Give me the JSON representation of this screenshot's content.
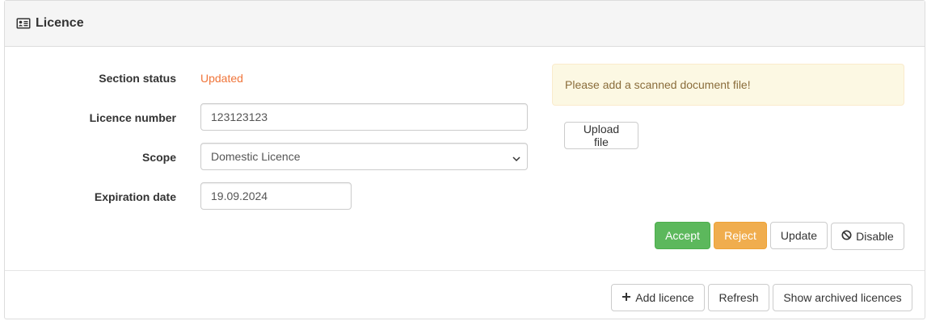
{
  "panel": {
    "title": "Licence",
    "title_icon": "id-card-icon"
  },
  "form": {
    "section_status": {
      "label": "Section status",
      "value": "Updated",
      "color": "#f0753a"
    },
    "licence_number": {
      "label": "Licence number",
      "value": "123123123"
    },
    "scope": {
      "label": "Scope",
      "selected": "Domestic Licence"
    },
    "expiration_date": {
      "label": "Expiration date",
      "value": "19.09.2024"
    }
  },
  "document": {
    "alert_text": "Please add a scanned document file!",
    "upload_label": "Upload file"
  },
  "actions": {
    "accept_label": "Accept",
    "reject_label": "Reject",
    "update_label": "Update",
    "disable_label": "Disable",
    "disable_icon": "ban-icon"
  },
  "footer": {
    "add_label": "Add licence",
    "add_icon": "plus-icon",
    "refresh_label": "Refresh",
    "archived_label": "Show archived licences"
  },
  "colors": {
    "accept": "#5cb85c",
    "reject": "#f0ad4e",
    "alert_bg": "#fcf8e3",
    "alert_text": "#8a6d3b"
  }
}
